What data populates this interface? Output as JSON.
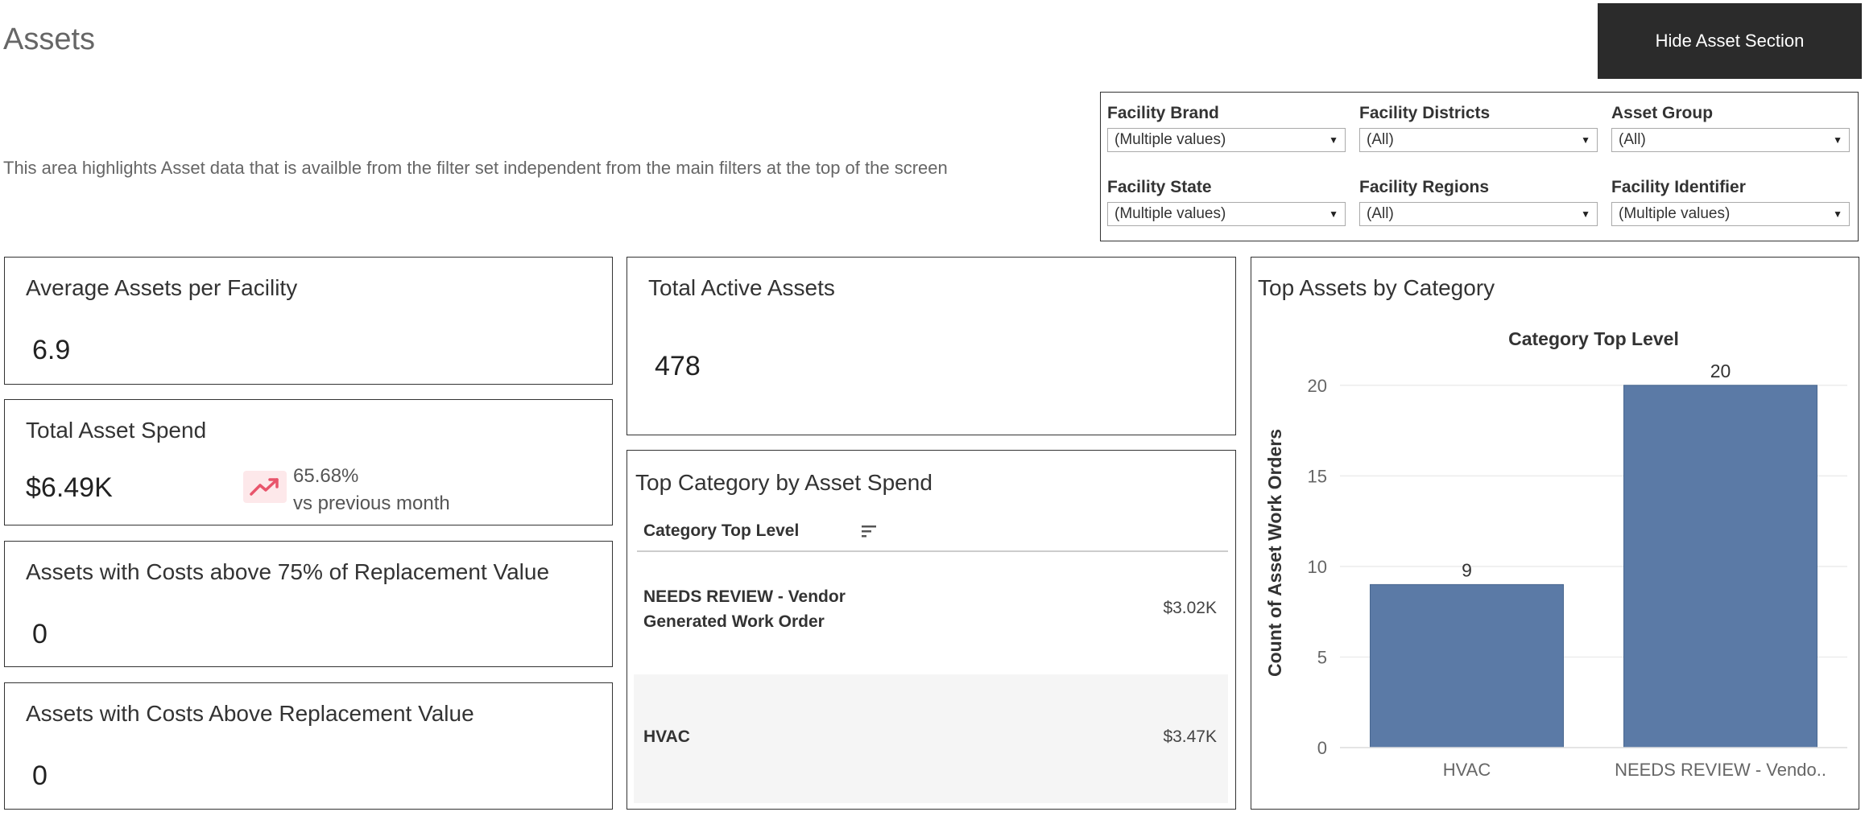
{
  "page": {
    "title": "Assets",
    "hide_button": "Hide Asset Section",
    "description": "This area highlights Asset data that is availble from the filter set independent from the main filters at the top of the screen"
  },
  "filters": [
    {
      "label": "Facility Brand",
      "value": "(Multiple values)"
    },
    {
      "label": "Facility Districts",
      "value": "(All)"
    },
    {
      "label": "Asset Group",
      "value": "(All)"
    },
    {
      "label": "Facility State",
      "value": "(Multiple values)"
    },
    {
      "label": "Facility Regions",
      "value": "(All)"
    },
    {
      "label": "Facility Identifier",
      "value": "(Multiple values)"
    }
  ],
  "kpis": {
    "avg_assets": {
      "title": "Average Assets per Facility",
      "value": "6.9"
    },
    "total_spend": {
      "title": "Total Asset Spend",
      "value": "$6.49K",
      "change": "65.68%",
      "change_label": "vs previous month"
    },
    "above_75": {
      "title": "Assets with Costs above 75% of Replacement Value",
      "value": "0"
    },
    "above_replacement": {
      "title": "Assets with Costs Above Replacement Value",
      "value": "0"
    },
    "total_active": {
      "title": "Total Active Assets",
      "value": "478"
    }
  },
  "top_category_spend": {
    "title": "Top Category by Asset Spend",
    "column_header": "Category Top Level",
    "rows": [
      {
        "line1": "NEEDS REVIEW - Vendor",
        "line2": "Generated Work Order",
        "value": "$3.02K"
      },
      {
        "line1": "HVAC",
        "line2": "",
        "value": "$3.47K"
      }
    ]
  },
  "top_assets_chart": {
    "panel_title": "Top Assets by Category",
    "bar_color": "#5b7aa6"
  },
  "chart_data": {
    "type": "bar",
    "title": "Category Top Level",
    "xlabel": "",
    "ylabel": "Count of Asset Work Orders",
    "categories": [
      "HVAC",
      "NEEDS REVIEW - Vendo.."
    ],
    "values": [
      9,
      20
    ],
    "ylim": [
      0,
      21.5
    ],
    "yticks": [
      0,
      5,
      10,
      15,
      20
    ],
    "grid": true
  },
  "colors": {
    "trend_icon": "#e8546b",
    "trend_bg": "#fde8ea"
  }
}
